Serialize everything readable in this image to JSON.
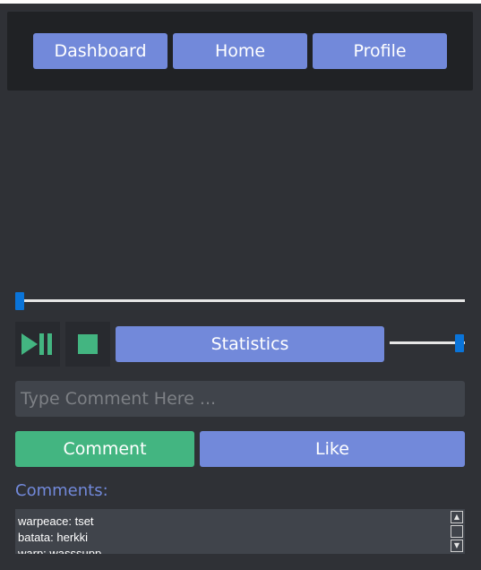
{
  "nav": {
    "items": [
      {
        "label": "Dashboard"
      },
      {
        "label": "Home"
      },
      {
        "label": "Profile"
      }
    ]
  },
  "controls": {
    "play_pause_icon": "play-pause-icon",
    "stop_icon": "stop-icon",
    "statistics_label": "Statistics",
    "seek_position": 0.0,
    "volume_level": 1.0
  },
  "comment_form": {
    "placeholder": "Type Comment Here ...",
    "value": "",
    "comment_label": "Comment",
    "like_label": "Like"
  },
  "comments": {
    "heading": "Comments:",
    "items": [
      {
        "text": "warpeace: tset"
      },
      {
        "text": "batata: herkki"
      },
      {
        "text": "warp: wasssupp"
      }
    ]
  },
  "colors": {
    "background": "#2f3136",
    "panel": "#202225",
    "primary": "#7289da",
    "success": "#43b581",
    "input": "#40444b",
    "slider_handle": "#0a74d9"
  }
}
